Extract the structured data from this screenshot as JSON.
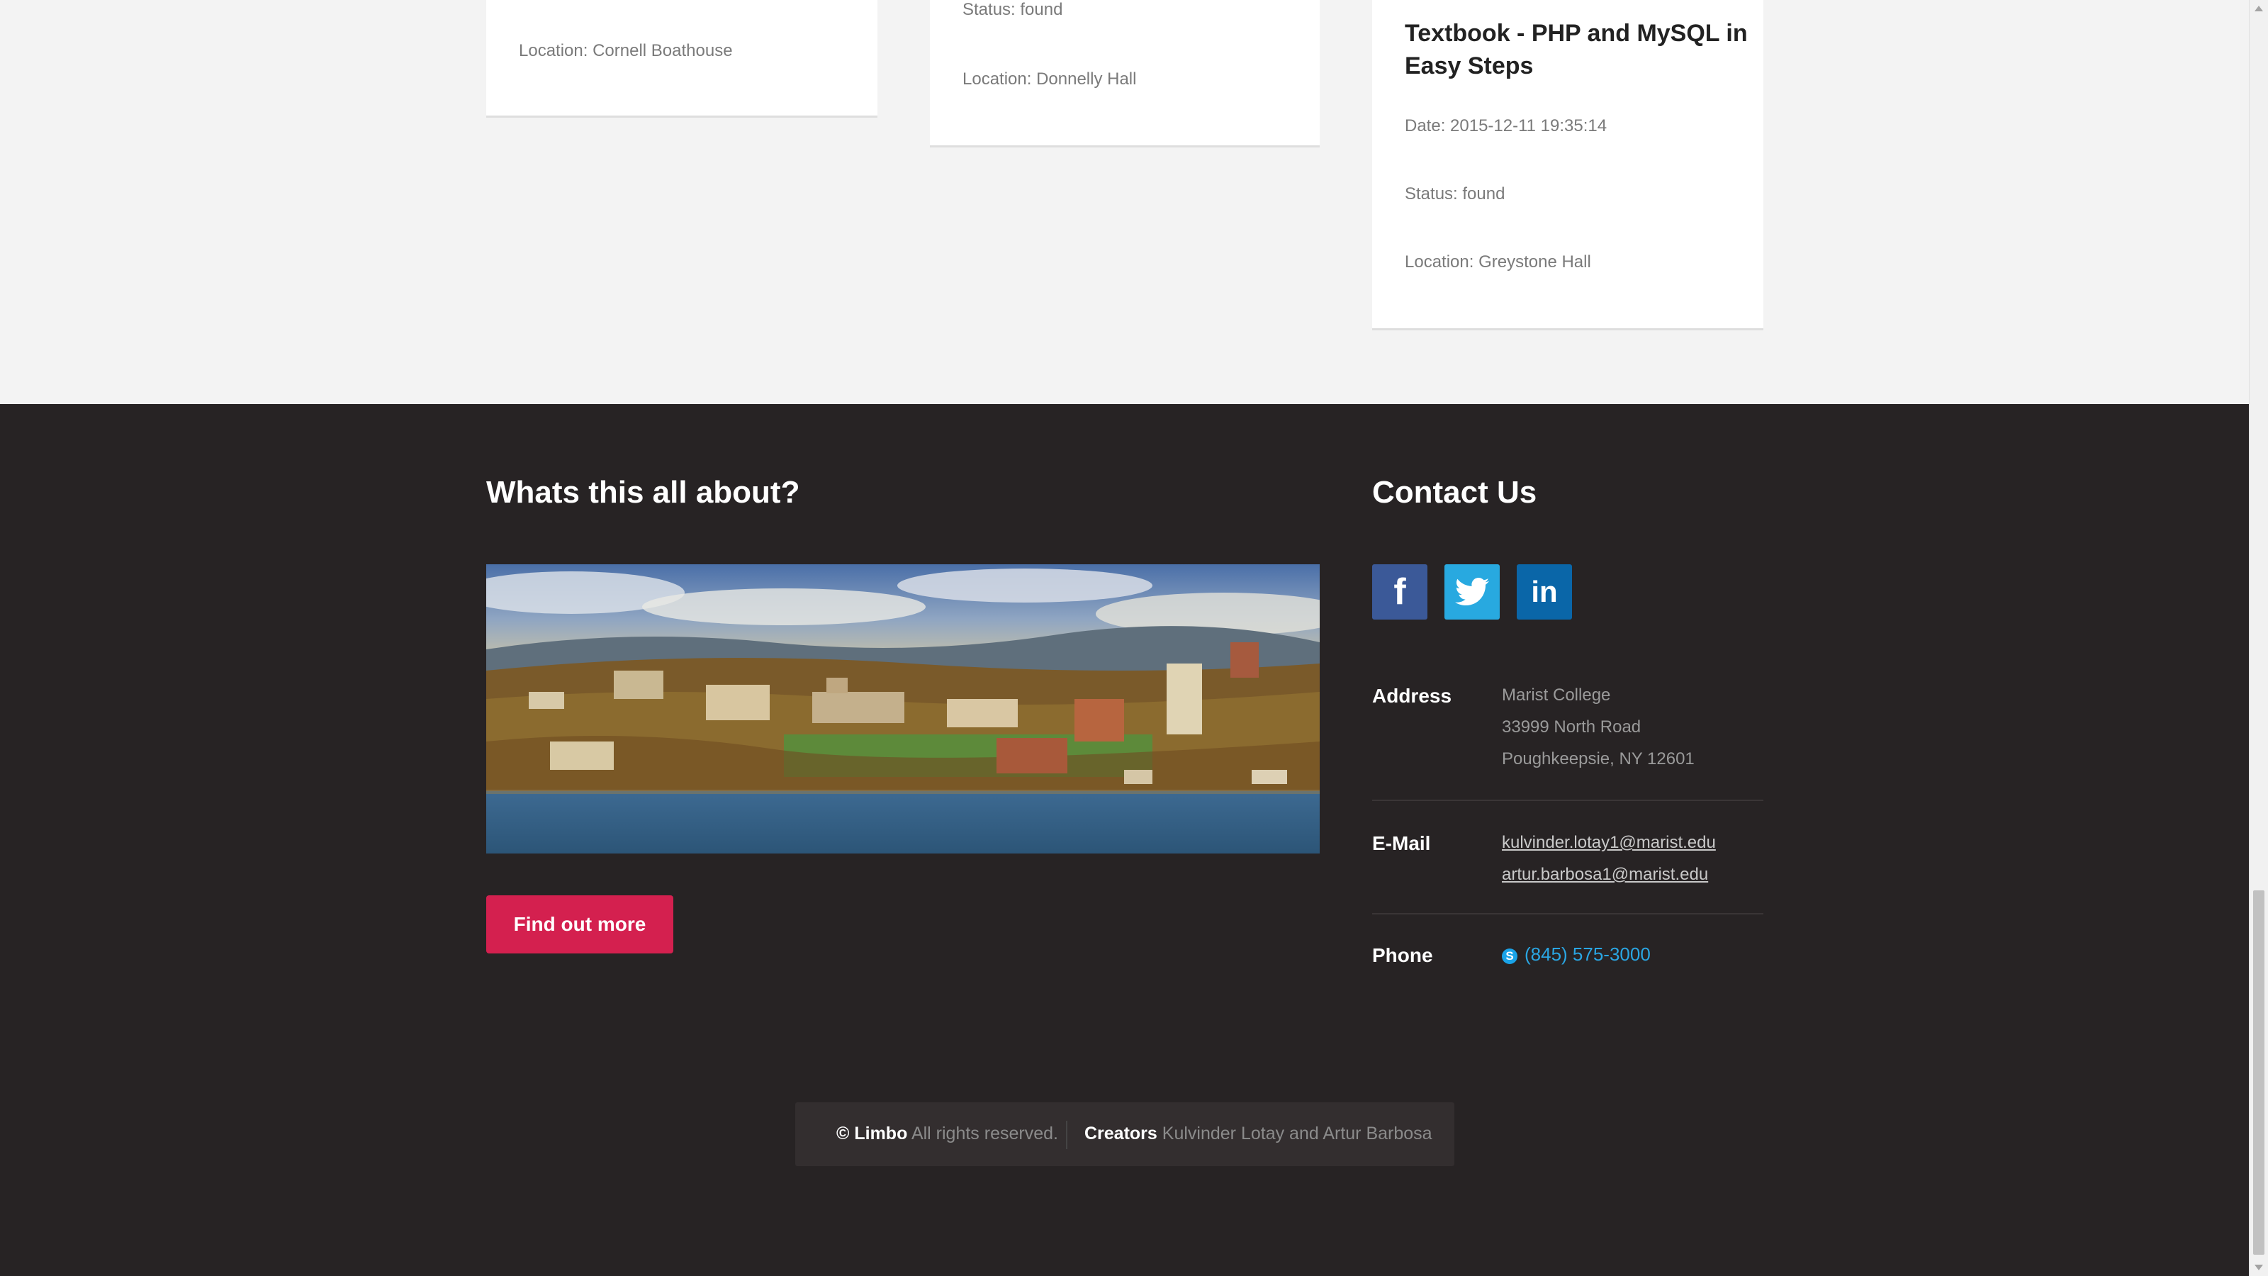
{
  "cards": [
    {
      "location": "Location: Cornell Boathouse"
    },
    {
      "status": "Status: found",
      "location": "Location: Donnelly Hall"
    },
    {
      "title": "Textbook - PHP and MySQL in Easy Steps",
      "date": "Date: 2015-12-11 19:35:14",
      "status": "Status: found",
      "location": "Location: Greystone Hall"
    }
  ],
  "about": {
    "heading": "Whats this all about?",
    "button_label": "Find out more"
  },
  "contact": {
    "heading": "Contact Us",
    "social": [
      "facebook-icon",
      "twitter-icon",
      "linkedin-icon"
    ],
    "address_label": "Address",
    "address_lines": [
      "Marist College",
      "33999 North Road",
      "Poughkeepsie, NY 12601"
    ],
    "email_label": "E-Mail",
    "emails": [
      "kulvinder.lotay1@marist.edu",
      "artur.barbosa1@marist.edu"
    ],
    "phone_label": "Phone",
    "phone": "(845) 575-3000"
  },
  "copyright": {
    "brand": "© Limbo",
    "rights": "All rights reserved.",
    "creators_label": "Creators",
    "creators": "Kulvinder Lotay and Artur Barbosa"
  },
  "colors": {
    "page_bg": "#f3f3f3",
    "footer_bg": "#272324",
    "accent": "#d4204f",
    "facebook": "#3b5998",
    "twitter": "#28a9e0",
    "linkedin": "#0a66a8",
    "phone_link": "#2aa6e3"
  }
}
